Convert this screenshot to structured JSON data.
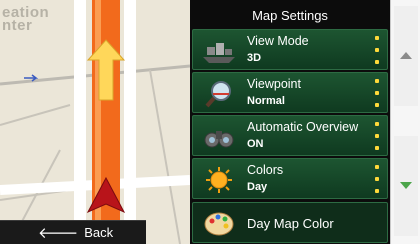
{
  "map": {
    "place_label": "eation\nnter"
  },
  "back_button": {
    "label": "Back"
  },
  "panel": {
    "title": "Map Settings",
    "items": [
      {
        "label": "View Mode",
        "value": "3D",
        "icon": "view-mode-3d-icon"
      },
      {
        "label": "Viewpoint",
        "value": "Normal",
        "icon": "viewpoint-magnifier-icon"
      },
      {
        "label": "Automatic Overview",
        "value": "ON",
        "icon": "binoculars-icon"
      },
      {
        "label": "Colors",
        "value": "Day",
        "icon": "sun-icon"
      },
      {
        "label": "Day Map Color",
        "icon": "palette-icon"
      }
    ]
  },
  "scrollbar": {
    "up_icon": "arrow-up-icon",
    "down_icon": "arrow-down-icon"
  },
  "colors": {
    "accent_green": "#1d5531",
    "route_orange": "#ff7a1f",
    "dots_yellow": "#ffd93a"
  }
}
